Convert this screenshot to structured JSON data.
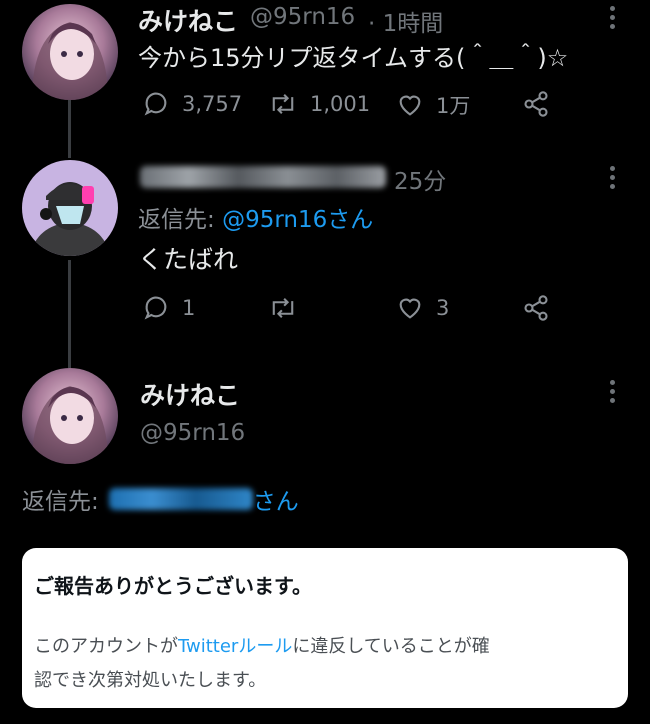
{
  "tweet1": {
    "name": "みけねこ",
    "handle": "@95rn16",
    "time": "· 1時間",
    "text": "今から15分リプ返タイムする(＾＿＾)☆",
    "replies": "3,757",
    "retweets": "1,001",
    "likes": "1万"
  },
  "tweet2": {
    "time": "25分",
    "reply_to_label": "返信先:",
    "reply_to_user": "@95rn16さん",
    "text": "くたばれ",
    "replies": "1",
    "likes": "3"
  },
  "tweet3": {
    "name": "みけねこ",
    "handle": "@95rn16",
    "reply_to_label": "返信先:",
    "reply_to_suffix": "さん"
  },
  "notice": {
    "title": "ご報告ありがとうございます。",
    "body_part1": "このアカウントが",
    "body_link": "Twitterルール",
    "body_part2": "に違反していることが確",
    "body_line2": "認でき次第対処いたします。"
  },
  "colors": {
    "background": "#000000",
    "accent": "#1d9bf0",
    "muted": "#71767b"
  }
}
